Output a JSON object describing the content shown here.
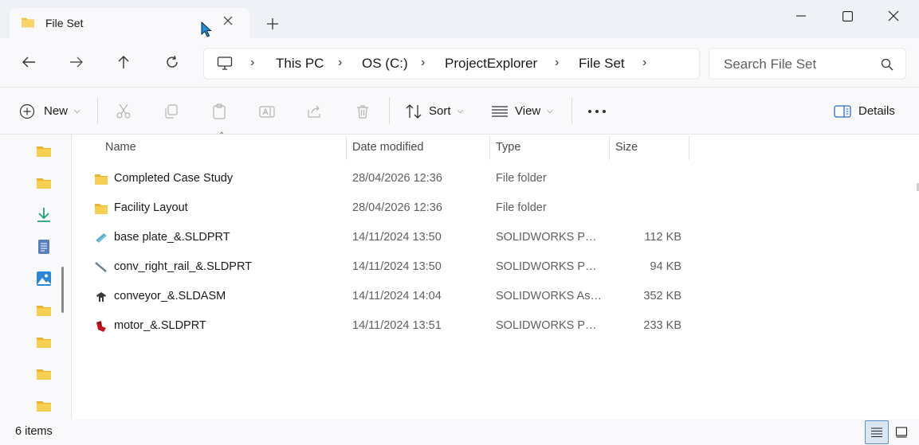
{
  "window": {
    "tab_title": "File Set",
    "tab_close_icon": "close-icon",
    "new_tab_icon": "plus-icon"
  },
  "nav": {
    "back_icon": "arrow-left-icon",
    "forward_icon": "arrow-right-icon",
    "up_icon": "arrow-up-icon",
    "refresh_icon": "refresh-icon"
  },
  "address": {
    "root_icon": "computer-icon",
    "crumbs": [
      "This PC",
      "OS (C:)",
      "ProjectExplorer",
      "File Set"
    ]
  },
  "search": {
    "placeholder": "Search File Set"
  },
  "toolbar": {
    "new_label": "New",
    "sort_label": "Sort",
    "view_label": "View",
    "details_label": "Details"
  },
  "columns": {
    "name": "Name",
    "date": "Date modified",
    "type": "Type",
    "size": "Size"
  },
  "files": [
    {
      "name": "Completed Case Study",
      "date": "28/04/2026 12:36",
      "type": "File folder",
      "size": "",
      "icon": "folder-icon"
    },
    {
      "name": "Facility Layout",
      "date": "28/04/2026 12:36",
      "type": "File folder",
      "size": "",
      "icon": "folder-icon"
    },
    {
      "name": "base plate_&.SLDPRT",
      "date": "14/11/2024 13:50",
      "type": "SOLIDWORKS Part Document",
      "size": "112 KB",
      "icon": "solidworks-part-icon"
    },
    {
      "name": "conv_right_rail_&.SLDPRT",
      "date": "14/11/2024 13:50",
      "type": "SOLIDWORKS Part Document",
      "size": "94 KB",
      "icon": "solidworks-part-icon"
    },
    {
      "name": "conveyor_&.SLDASM",
      "date": "14/11/2024 14:04",
      "type": "SOLIDWORKS Assembly Document",
      "size": "352 KB",
      "icon": "solidworks-assembly-icon"
    },
    {
      "name": "motor_&.SLDPRT",
      "date": "14/11/2024 13:51",
      "type": "SOLIDWORKS Part Document",
      "size": "233 KB",
      "icon": "solidworks-part-icon"
    }
  ],
  "status": {
    "item_count": "6 items"
  },
  "colors": {
    "folder": "#f4c542",
    "accent": "#2b6cc4",
    "download": "#1aa37a"
  }
}
